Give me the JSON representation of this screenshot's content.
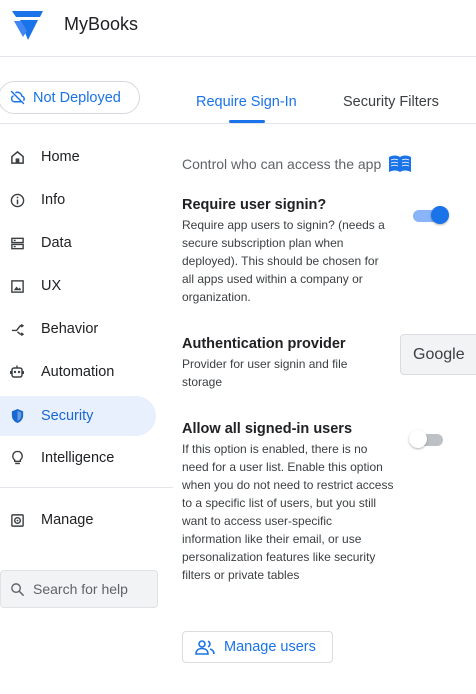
{
  "header": {
    "app_title": "MyBooks",
    "logo_icon": "appsheet-logo-icon"
  },
  "deploy": {
    "status_label": "Not Deployed",
    "icon": "not-deployed-icon"
  },
  "tabs": [
    {
      "label": "Require Sign-In",
      "active": true
    },
    {
      "label": "Security Filters",
      "active": false
    }
  ],
  "sidebar": {
    "items": [
      {
        "label": "Home",
        "icon": "home-icon"
      },
      {
        "label": "Info",
        "icon": "info-icon"
      },
      {
        "label": "Data",
        "icon": "data-icon"
      },
      {
        "label": "UX",
        "icon": "ux-icon"
      },
      {
        "label": "Behavior",
        "icon": "behavior-icon"
      },
      {
        "label": "Automation",
        "icon": "automation-icon"
      },
      {
        "label": "Security",
        "icon": "shield-icon",
        "active": true
      },
      {
        "label": "Intelligence",
        "icon": "lightbulb-icon"
      }
    ],
    "manage": {
      "label": "Manage",
      "icon": "manage-icon"
    },
    "search": {
      "placeholder": "Search for help"
    }
  },
  "main": {
    "intro": "Control who can access the app",
    "require_signin": {
      "title": "Require user signin?",
      "description": "Require app users to signin? (needs a secure subscription plan when deployed). This should be chosen for all apps used within a company or organization.",
      "enabled": true
    },
    "auth_provider": {
      "title": "Authentication provider",
      "description": "Provider for user signin and file storage",
      "value": "Google"
    },
    "allow_all": {
      "title": "Allow all signed-in users",
      "description": "If this option is enabled, there is no need for a user list. Enable this option when you do not need to restrict access to a specific list of users, but you still want to access user-specific information like their email, or use personalization features like security filters or private tables",
      "enabled": false
    },
    "manage_users_label": "Manage users"
  },
  "colors": {
    "accent": "#1a73e8",
    "active_bg": "#e8f0fe"
  }
}
